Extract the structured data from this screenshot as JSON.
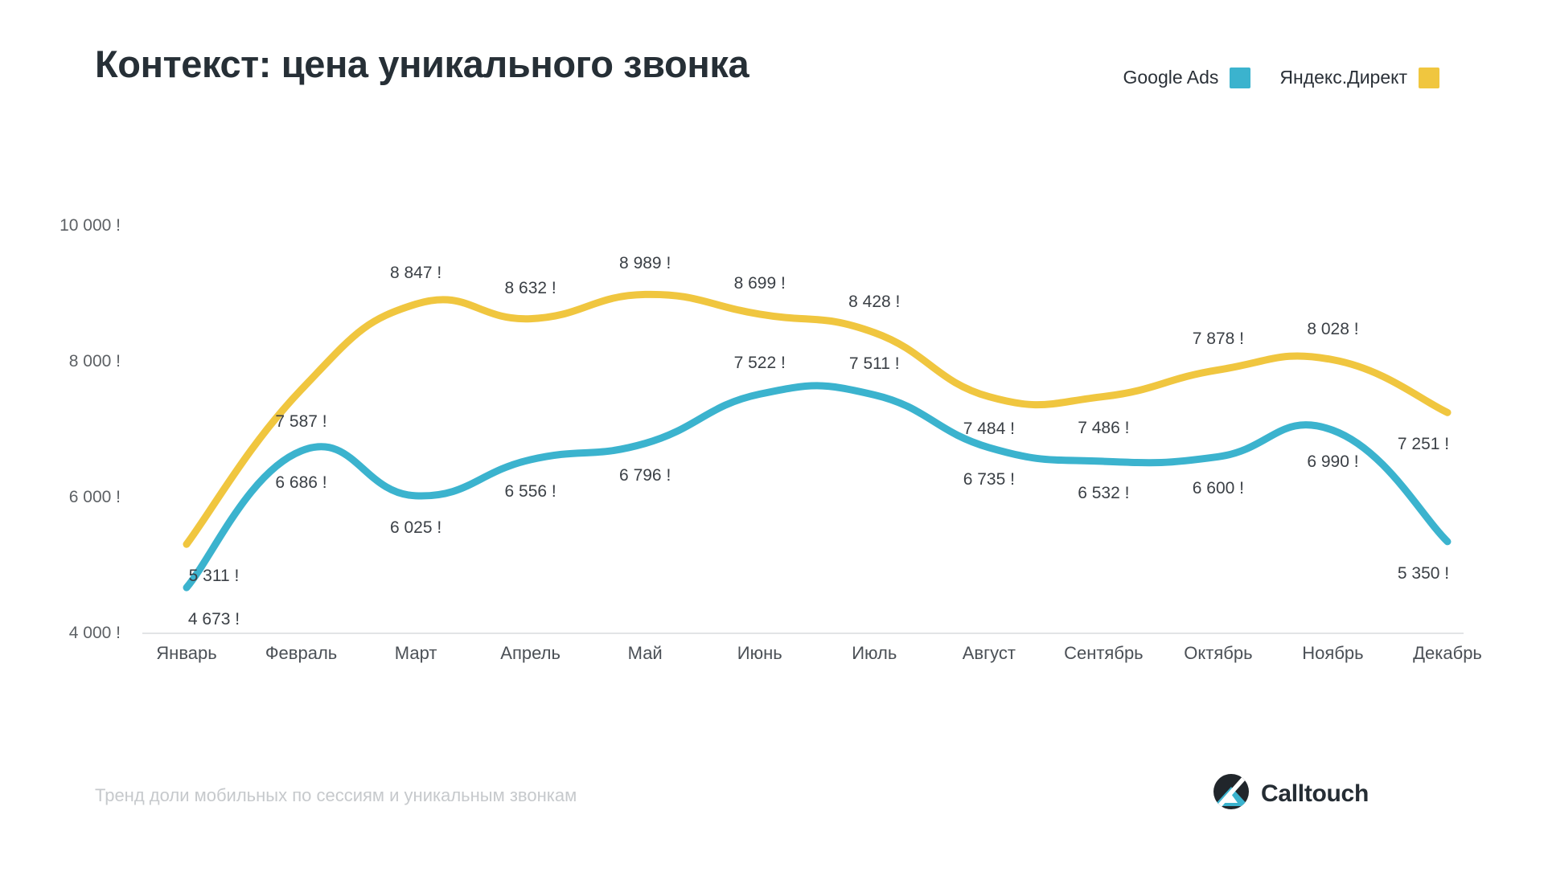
{
  "header": {
    "title": "Контекст: цена уникального звонка"
  },
  "legend": {
    "items": [
      {
        "label": "Google Ads",
        "color": "#3bb3ce",
        "swatch_icon": "square-swatch-icon"
      },
      {
        "label": "Яндекс.Директ",
        "color": "#f0c63f",
        "swatch_icon": "square-swatch-icon"
      }
    ]
  },
  "footer": {
    "note": "Тренд доли мобильных по сессиям и уникальным звонкам",
    "brand_name": "Calltouch",
    "brand_logo_icon": "calltouch-logo-icon"
  },
  "chart_data": {
    "type": "line",
    "title": "Контекст: цена уникального звонка",
    "xlabel": "",
    "ylabel": "",
    "ylim": [
      4000,
      10000
    ],
    "yticks": [
      4000,
      6000,
      8000,
      10000
    ],
    "ytick_labels": [
      "4 000 !",
      "6 000 !",
      "8 000 !",
      "10 000 !"
    ],
    "grid": false,
    "legend_position": "top-right",
    "currency_suffix": "!",
    "categories": [
      "Январь",
      "Февраль",
      "Март",
      "Апрель",
      "Май",
      "Июнь",
      "Июль",
      "Август",
      "Сентябрь",
      "Октябрь",
      "Ноябрь",
      "Декабрь"
    ],
    "series": [
      {
        "name": "Google Ads",
        "color": "#3bb3ce",
        "values": [
          4673,
          6686,
          6025,
          6556,
          6796,
          7522,
          7511,
          6735,
          6532,
          6600,
          6990,
          5350
        ],
        "labels": [
          "4 673 !",
          "6 686 !",
          "6 025 !",
          "6 556 !",
          "6 796 !",
          "7 522 !",
          "7 511 !",
          "6 735 !",
          "6 532 !",
          "6 600 !",
          "6 990 !",
          "5 350 !"
        ],
        "label_positions": [
          "below",
          "below",
          "below",
          "below",
          "below",
          "above",
          "above",
          "below",
          "below",
          "below",
          "below",
          "below"
        ]
      },
      {
        "name": "Яндекс.Директ",
        "color": "#f0c63f",
        "values": [
          5311,
          7587,
          8847,
          8632,
          8989,
          8699,
          8428,
          7484,
          7486,
          7878,
          8028,
          7251
        ],
        "labels": [
          "5 311 !",
          "7 587 !",
          "8 847 !",
          "8 632 !",
          "8 989 !",
          "8 699 !",
          "8 428 !",
          "7 484 !",
          "7 486 !",
          "7 878 !",
          "8 028 !",
          "7 251 !"
        ],
        "label_positions": [
          "below",
          "below",
          "above",
          "above",
          "above",
          "above",
          "above",
          "below",
          "below",
          "above",
          "above",
          "below"
        ]
      }
    ]
  }
}
